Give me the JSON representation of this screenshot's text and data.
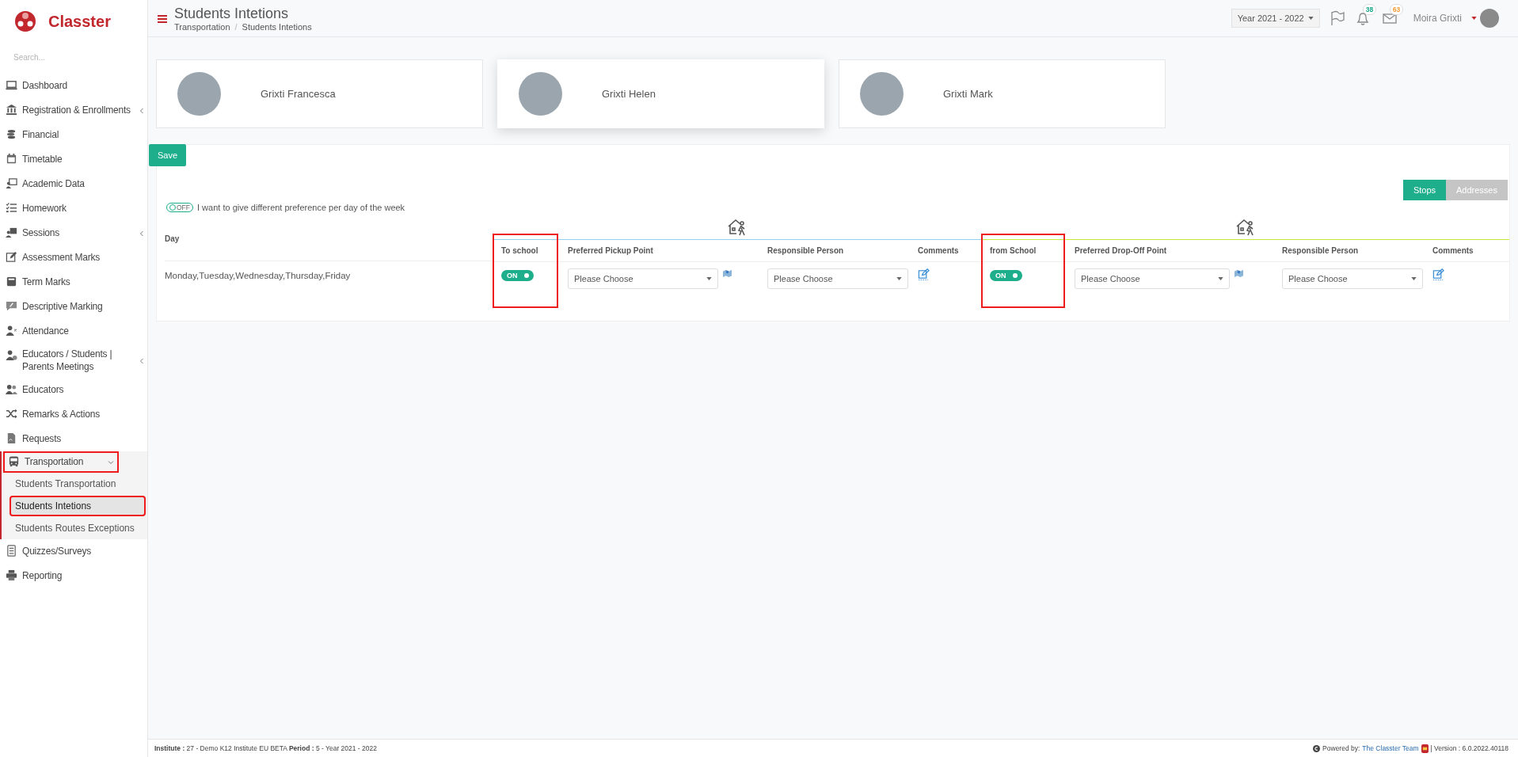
{
  "app": {
    "logo": "Classter",
    "search_placeholder": "Search..."
  },
  "sidebar": [
    {
      "label": "Dashboard",
      "selected": false,
      "annotated": false
    },
    {
      "label": "Registration & Enrollments",
      "selected": false,
      "annotated": false,
      "expanded": false
    },
    {
      "label": "Financial",
      "selected": false,
      "annotated": false
    },
    {
      "label": "Timetable",
      "selected": false,
      "annotated": false
    },
    {
      "label": "Academic Data",
      "selected": false,
      "annotated": false
    },
    {
      "label": "Homework",
      "selected": false,
      "annotated": false
    },
    {
      "label": "Sessions",
      "selected": false,
      "annotated": false,
      "expanded": false
    },
    {
      "label": "Assessment Marks",
      "selected": false,
      "annotated": false
    },
    {
      "label": "Term Marks",
      "selected": false,
      "annotated": false
    },
    {
      "label": "Descriptive Marking",
      "selected": false,
      "annotated": false
    },
    {
      "label": "Attendance",
      "selected": false,
      "annotated": false
    },
    {
      "label": "Educators / Students | Parents Meetings",
      "selected": false,
      "annotated": false,
      "expanded": false
    },
    {
      "label": "Educators",
      "selected": false,
      "annotated": false
    },
    {
      "label": "Remarks & Actions",
      "selected": false,
      "annotated": false
    },
    {
      "label": "Requests",
      "selected": false,
      "annotated": false
    },
    {
      "label": "Transportation",
      "selected": true,
      "annotated": true,
      "expanded": true,
      "children": [
        {
          "label": "Students Transportation",
          "selected": false,
          "annotated": false
        },
        {
          "label": "Students Intetions",
          "selected": true,
          "annotated": true
        },
        {
          "label": "Students Routes Exceptions",
          "selected": false,
          "annotated": false
        }
      ]
    },
    {
      "label": "Quizzes/Surveys",
      "selected": false,
      "annotated": false
    },
    {
      "label": "Reporting",
      "selected": false,
      "annotated": false
    }
  ],
  "header": {
    "title": "Students Intetions",
    "breadcrumb": [
      "Transportation",
      "Students Intetions"
    ],
    "breadcrumb_separator": "/",
    "year": "Year 2021 - 2022",
    "notifications": "38",
    "messages": "63",
    "user": "Moira Grixti"
  },
  "students": [
    {
      "name": "Grixti Francesca",
      "selected": false
    },
    {
      "name": "Grixti Helen",
      "selected": true
    },
    {
      "name": "Grixti Mark",
      "selected": false
    }
  ],
  "save_button": "Save",
  "view_buttons": [
    {
      "label": "Stops",
      "selected": true
    },
    {
      "label": "Addresses",
      "selected": false
    }
  ],
  "per_day_toggle": {
    "state_label": "OFF",
    "on": false,
    "text": "I want to give different preference per day of the week"
  },
  "table": {
    "day_header": "Day",
    "day": "Monday,Tuesday,Wednesday,Thursday,Friday",
    "groups": [
      {
        "color": "#8fd3f0",
        "columns": [
          {
            "label": "To school",
            "kind": "toggle",
            "state_label": "ON",
            "on": true,
            "annotated": true
          },
          {
            "label": "Preferred Pickup Point",
            "kind": "select-map",
            "value": "Please Choose",
            "annotated": false
          },
          {
            "label": "Responsible Person",
            "kind": "select",
            "value": "Please Choose",
            "annotated": false
          },
          {
            "label": "Comments",
            "kind": "edit",
            "annotated": false
          }
        ]
      },
      {
        "color": "#c5ec3a",
        "columns": [
          {
            "label": "from School",
            "kind": "toggle",
            "state_label": "ON",
            "on": true,
            "annotated": true
          },
          {
            "label": "Preferred Drop-Off Point",
            "kind": "select-map",
            "value": "Please Choose",
            "annotated": false
          },
          {
            "label": "Responsible Person",
            "kind": "select",
            "value": "Please Choose",
            "annotated": false
          },
          {
            "label": "Comments",
            "kind": "edit",
            "annotated": false
          }
        ]
      }
    ]
  },
  "footer": {
    "info": "**Institute :** 27 - Demo K12 Institute EU BETA **Period :** 5 - Year 2021 - 2022",
    "powered": "Powered by:",
    "link": "The Classter Team",
    "version": "| Version : 6.0.2022.40118"
  }
}
